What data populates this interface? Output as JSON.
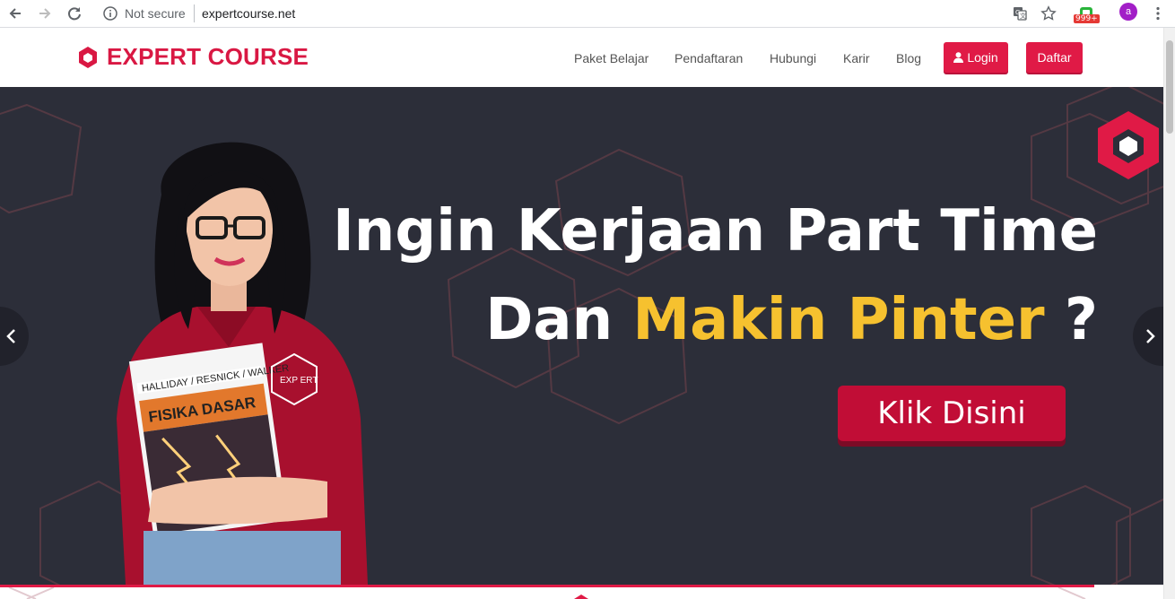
{
  "browser": {
    "security_label": "Not secure",
    "url": "expertcourse.net",
    "extension_badge": "999+",
    "profile_initial": "a"
  },
  "site": {
    "brand": "EXPERT COURSE",
    "nav": [
      {
        "label": "Paket Belajar"
      },
      {
        "label": "Pendaftaran"
      },
      {
        "label": "Hubungi"
      },
      {
        "label": "Karir"
      },
      {
        "label": "Blog"
      }
    ],
    "login_label": "Login",
    "register_label": "Daftar"
  },
  "hero": {
    "line1": "Ingin Kerjaan Part Time",
    "line2_prefix": "Dan ",
    "line2_highlight": "Makin Pinter",
    "line2_suffix": " ?",
    "cta_label": "Klik Disini",
    "badge_text": "EXP ERT",
    "book_authors": "HALLIDAY / RESNICK / WALKER",
    "book_title": "FISIKA DASAR"
  },
  "colors": {
    "brand_red": "#e01a46",
    "hero_bg": "#2c2e39",
    "highlight_yellow": "#f6c12f"
  }
}
